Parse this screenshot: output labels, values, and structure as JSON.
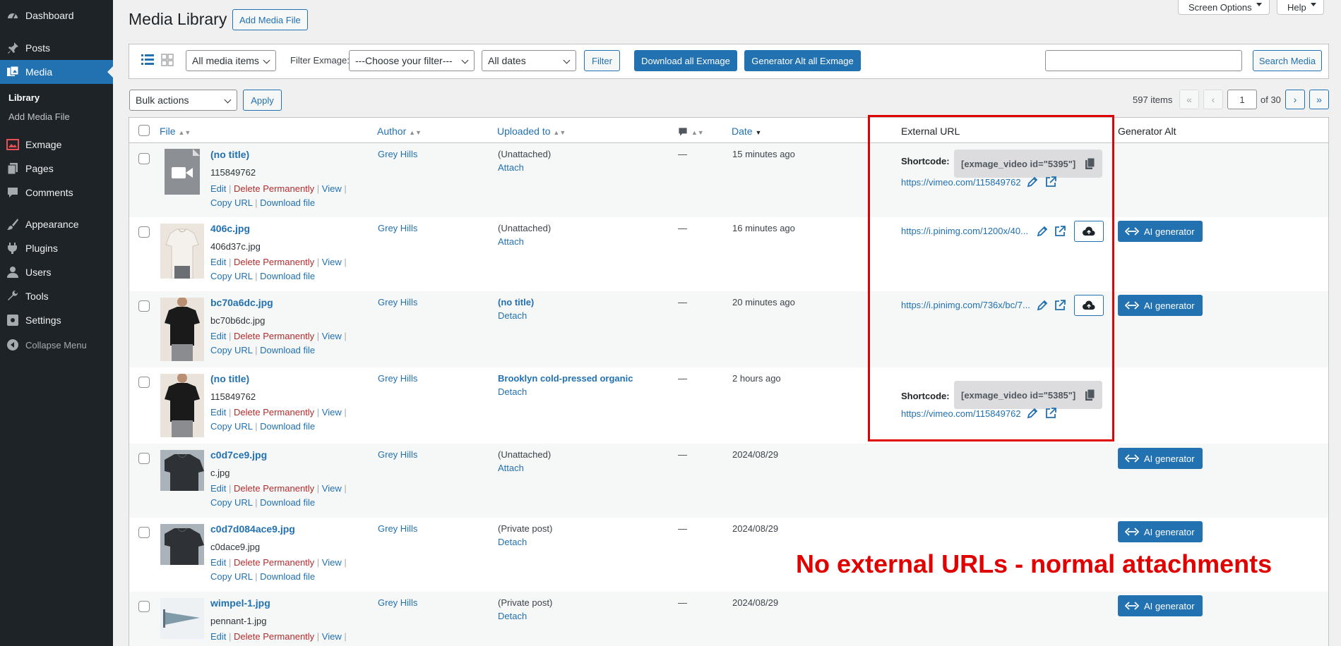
{
  "sidebar": {
    "items": [
      {
        "label": "Dashboard",
        "icon": "dashboard-icon"
      },
      {
        "label": "Posts",
        "icon": "pin-icon"
      },
      {
        "label": "Media",
        "icon": "media-icon"
      },
      {
        "label": "Exmage",
        "icon": "exmage-icon"
      },
      {
        "label": "Pages",
        "icon": "pages-icon"
      },
      {
        "label": "Comments",
        "icon": "comments-icon"
      },
      {
        "label": "Appearance",
        "icon": "brush-icon"
      },
      {
        "label": "Plugins",
        "icon": "plugin-icon"
      },
      {
        "label": "Users",
        "icon": "user-icon"
      },
      {
        "label": "Tools",
        "icon": "wrench-icon"
      },
      {
        "label": "Settings",
        "icon": "settings-icon"
      }
    ],
    "submenu": [
      "Library",
      "Add Media File"
    ],
    "collapse": "Collapse Menu"
  },
  "header": {
    "title": "Media Library",
    "add_button": "Add Media File",
    "screen_options": "Screen Options",
    "help": "Help"
  },
  "toolbar": {
    "media_type": "All media items",
    "filter_label": "Filter Exmage:",
    "filter_select": "---Choose your filter---",
    "dates": "All dates",
    "filter_button": "Filter",
    "download_all": "Download all Exmage",
    "generator_alt_all": "Generator Alt all Exmage",
    "search_placeholder": "",
    "search_button": "Search Media"
  },
  "bulk": {
    "select": "Bulk actions",
    "apply": "Apply"
  },
  "pagination": {
    "items": "597 items",
    "first": "«",
    "prev": "‹",
    "current": "1",
    "of": "of 30",
    "next": "›",
    "last": "»"
  },
  "columns": {
    "file": "File",
    "author": "Author",
    "uploaded_to": "Uploaded to",
    "date": "Date",
    "external_url": "External URL",
    "generator_alt": "Generator Alt"
  },
  "actions": {
    "edit": "Edit",
    "delete": "Delete Permanently",
    "view": "View",
    "copy": "Copy URL",
    "download": "Download file"
  },
  "rows": [
    {
      "title": "(no title)",
      "filename": "115849762",
      "author": "Grey Hills",
      "up1": "(Unattached)",
      "up2": "Attach",
      "comments": "—",
      "date": "15 minutes ago",
      "shortcode_label": "Shortcode:",
      "shortcode": "[exmage_video id=\"5395\"]",
      "url": "https://vimeo.com/115849762",
      "ai": ""
    },
    {
      "title": "406c.jpg",
      "filename": "406d37c.jpg",
      "author": "Grey Hills",
      "up1": "(Unattached)",
      "up2": "Attach",
      "comments": "—",
      "date": "16 minutes ago",
      "url": "https://i.pinimg.com/1200x/40...",
      "ai": "AI generator"
    },
    {
      "title": "bc70a6dc.jpg",
      "filename": "bc70b6dc.jpg",
      "author": "Grey Hills",
      "up1": "(no title)",
      "up2": "Detach",
      "comments": "—",
      "date": "20 minutes ago",
      "url": "https://i.pinimg.com/736x/bc/7...",
      "ai": "AI generator"
    },
    {
      "title": "(no title)",
      "filename": "115849762",
      "author": "Grey Hills",
      "up1": "Brooklyn cold-pressed organic",
      "up2": "Detach",
      "comments": "—",
      "date": "2 hours ago",
      "shortcode_label": "Shortcode:",
      "shortcode": "[exmage_video id=\"5385\"]",
      "url": "https://vimeo.com/115849762",
      "ai": ""
    },
    {
      "title": "c0d7ce9.jpg",
      "filename": "c.jpg",
      "author": "Grey Hills",
      "up1": "(Unattached)",
      "up2": "Attach",
      "comments": "—",
      "date": "2024/08/29",
      "ai": "AI generator"
    },
    {
      "title": "c0d7d084ace9.jpg",
      "filename": "c0dace9.jpg",
      "author": "Grey Hills",
      "up1": "(Private post)",
      "up2": "Detach",
      "comments": "—",
      "date": "2024/08/29",
      "ai": "AI generator"
    },
    {
      "title": "wimpel-1.jpg",
      "filename": "pennant-1.jpg",
      "author": "Grey Hills",
      "up1": "(Private post)",
      "up2": "Detach",
      "comments": "—",
      "date": "2024/08/29",
      "ai": "AI generator"
    }
  ],
  "annotation": "No external URLs - normal attachments",
  "colors": {
    "accent": "#2271b1",
    "sidebar": "#1d2327",
    "annotation": "#e00000",
    "delete": "#b32d2e"
  }
}
